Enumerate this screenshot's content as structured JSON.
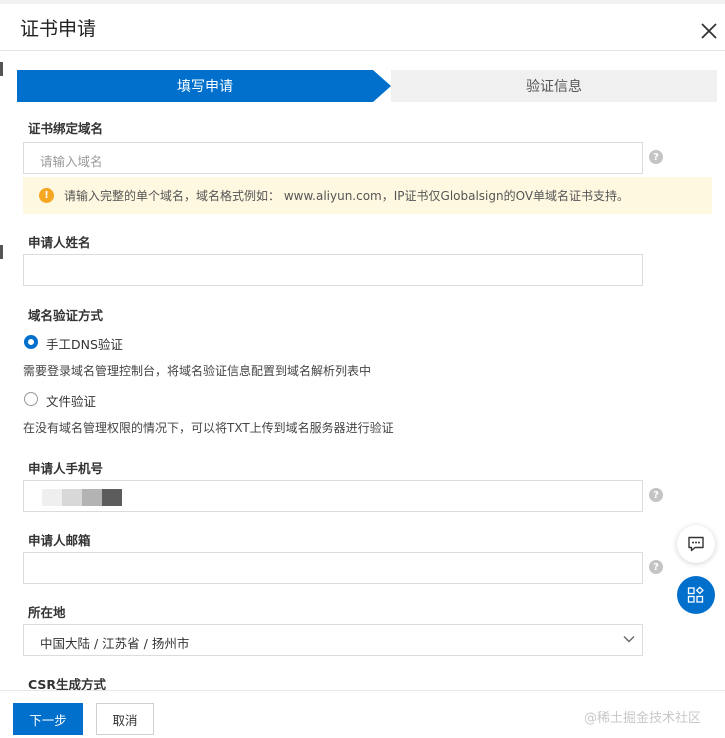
{
  "dialog": {
    "title": "证书申请",
    "close_icon": "close-icon"
  },
  "steps": [
    {
      "label": "填写申请",
      "active": true
    },
    {
      "label": "验证信息",
      "active": false
    }
  ],
  "form": {
    "domain": {
      "label": "证书绑定域名",
      "placeholder": "请输入域名",
      "help": "?"
    },
    "alert": {
      "icon": "warning-icon",
      "icon_glyph": "!",
      "text": "请输入完整的单个域名，域名格式例如： www.aliyun.com，IP证书仅Globalsign的OV单域名证书支持。"
    },
    "applicant_name": {
      "label": "申请人姓名",
      "value": ""
    },
    "verification": {
      "label": "域名验证方式",
      "options": [
        {
          "label": "手工DNS验证",
          "description": "需要登录域名管理控制台，将域名验证信息配置到域名解析列表中",
          "checked": true
        },
        {
          "label": "文件验证",
          "description": "在没有域名管理权限的情况下，可以将TXT上传到域名服务器进行验证",
          "checked": false
        }
      ]
    },
    "phone": {
      "label": "申请人手机号",
      "help": "?"
    },
    "email": {
      "label": "申请人邮箱",
      "help": "?"
    },
    "location": {
      "label": "所在地",
      "value": "中国大陆 / 江苏省 / 扬州市"
    },
    "csr": {
      "label": "CSR生成方式"
    }
  },
  "footer": {
    "next_label": "下一步",
    "cancel_label": "取消",
    "watermark": "@稀土掘金技术社区"
  },
  "colors": {
    "accent": "#0070cc",
    "alert_bg": "#fff8e0",
    "warning": "#f5a623"
  }
}
